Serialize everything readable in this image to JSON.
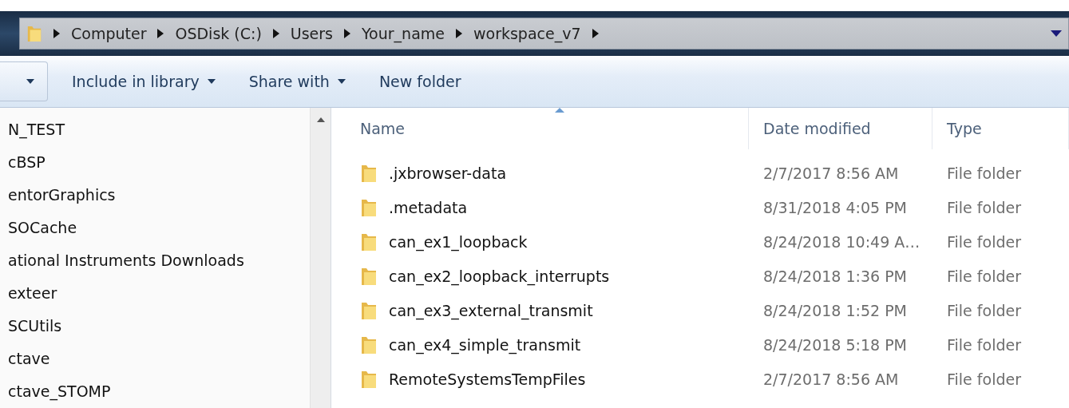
{
  "breadcrumb": [
    "Computer",
    "OSDisk (C:)",
    "Users",
    "Your_name",
    "workspace_v7"
  ],
  "toolbar": {
    "items": [
      "Include in library",
      "Share with",
      "New folder"
    ]
  },
  "sidebar": {
    "items": [
      "N_TEST",
      "cBSP",
      "entorGraphics",
      "SOCache",
      "ational Instruments Downloads",
      "exteer",
      "SCUtils",
      "ctave",
      "ctave_STOMP"
    ]
  },
  "table": {
    "columns": [
      "Name",
      "Date modified",
      "Type"
    ],
    "rows": [
      {
        "name": ".jxbrowser-data",
        "date": "2/7/2017 8:56 AM",
        "type": "File folder"
      },
      {
        "name": ".metadata",
        "date": "8/31/2018 4:05 PM",
        "type": "File folder"
      },
      {
        "name": "can_ex1_loopback",
        "date": "8/24/2018 10:49 A…",
        "type": "File folder"
      },
      {
        "name": "can_ex2_loopback_interrupts",
        "date": "8/24/2018 1:36 PM",
        "type": "File folder"
      },
      {
        "name": "can_ex3_external_transmit",
        "date": "8/24/2018 1:52 PM",
        "type": "File folder"
      },
      {
        "name": "can_ex4_simple_transmit",
        "date": "8/24/2018 5:18 PM",
        "type": "File folder"
      },
      {
        "name": "RemoteSystemsTempFiles",
        "date": "2/7/2017 8:56 AM",
        "type": "File folder"
      }
    ]
  }
}
